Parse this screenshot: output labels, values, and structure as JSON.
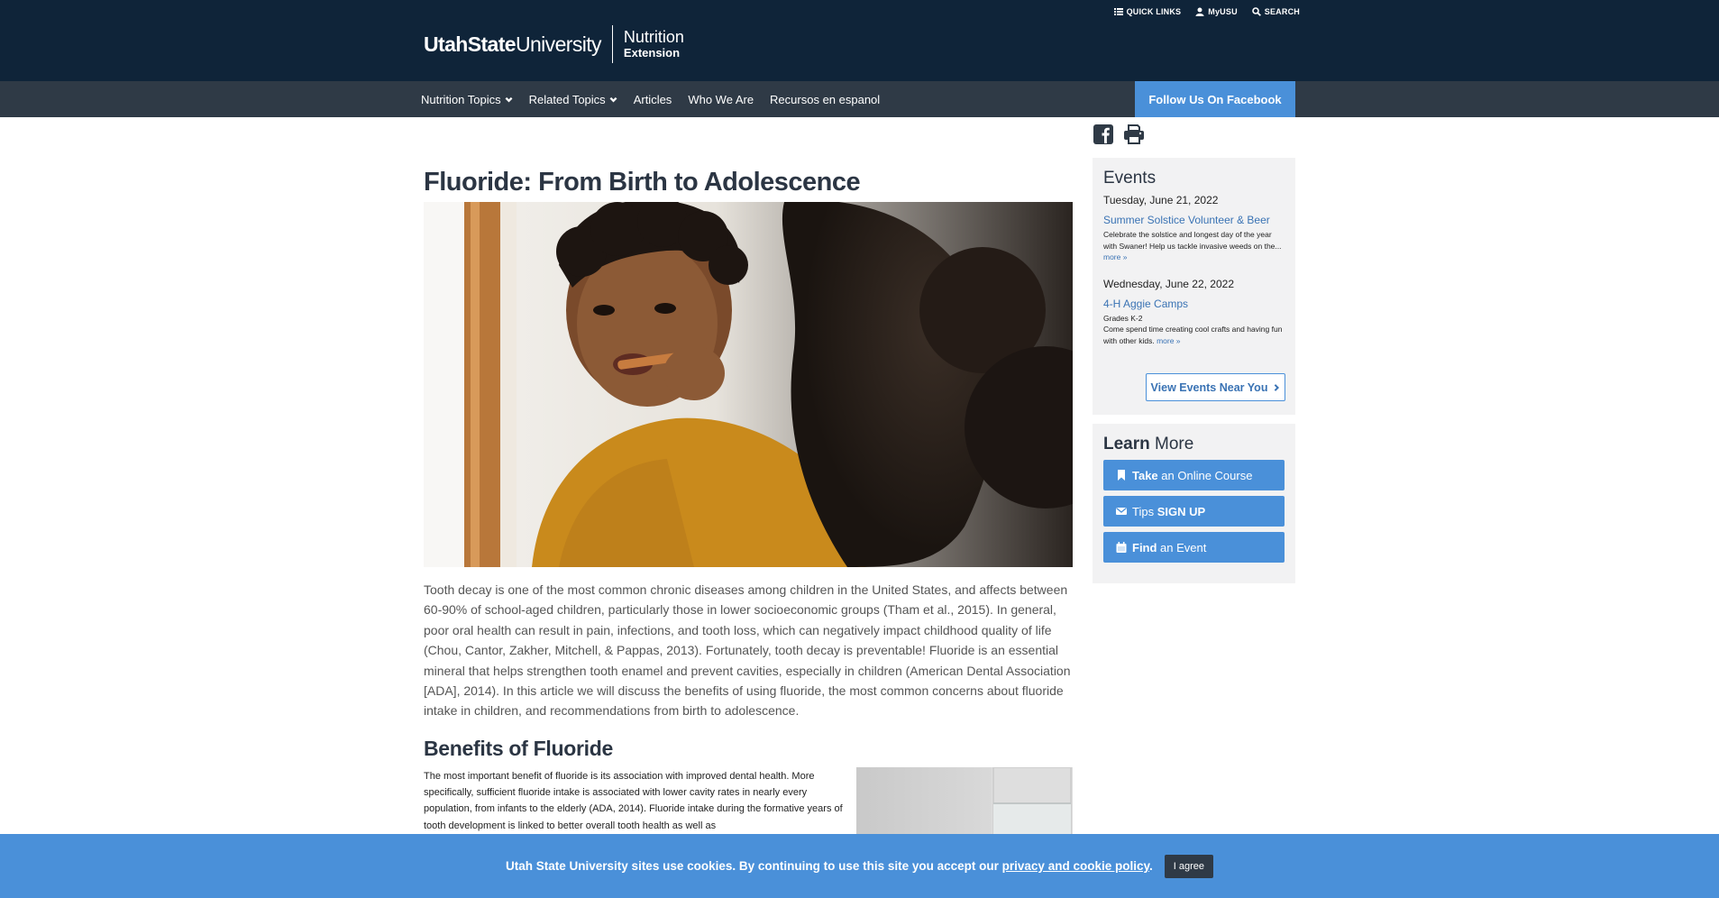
{
  "header": {
    "logo_bold": "UtahState",
    "logo_regular": "University",
    "unit_title": "Nutrition",
    "unit_subtitle": "Extension",
    "utility_links": [
      {
        "label": "QUICK LINKS",
        "icon": "list-icon"
      },
      {
        "label": "MyUSU",
        "icon": "user-icon"
      },
      {
        "label": "SEARCH",
        "icon": "search-icon"
      }
    ]
  },
  "nav": {
    "items": [
      {
        "label": "Nutrition Topics",
        "has_dropdown": true
      },
      {
        "label": "Related Topics",
        "has_dropdown": true
      },
      {
        "label": "Articles",
        "has_dropdown": false
      },
      {
        "label": "Who We Are",
        "has_dropdown": false
      },
      {
        "label": "Recursos en espanol",
        "has_dropdown": false
      }
    ],
    "facebook_button": "Follow Us On Facebook"
  },
  "article": {
    "title": "Fluoride: From Birth to Adolescence",
    "intro": "Tooth decay is one of the most common chronic diseases among children in the United States, and affects between 60-90% of school-aged children, particularly those in lower socioeconomic groups (Tham et al., 2015). In general, poor oral health can result in pain, infections, and tooth loss, which can negatively impact childhood quality of life (Chou, Cantor, Zakher, Mitchell, & Pappas, 2013). Fortunately, tooth decay is preventable! Fluoride is an essential mineral that helps strengthen tooth enamel and prevent cavities, especially in children (American Dental Association [ADA], 2014). In this article we will discuss the benefits of using fluoride, the most common concerns about fluoride intake in children, and recommendations from birth to adolescence.",
    "section_heading": "Benefits of Fluoride",
    "section_body": "The most important benefit of fluoride is its association with improved dental health. More specifically, sufficient fluoride intake is associated with lower cavity rates in nearly every population, from infants to the elderly (ADA, 2014). Fluoride intake during the formative years of tooth development is linked to better overall tooth health as well as"
  },
  "sidebar": {
    "events_title": "Events",
    "events": [
      {
        "date": "Tuesday, June 21, 2022",
        "title": "Summer Solstice Volunteer & Beer",
        "sub": "",
        "desc": "Celebrate the solstice and longest day of the year with Swaner! Help us tackle invasive weeds on the...",
        "more": "more »"
      },
      {
        "date": "Wednesday, June 22, 2022",
        "title": "4-H Aggie Camps",
        "sub": "Grades K-2",
        "desc": "Come spend time creating cool crafts and having fun with other kids.",
        "more": "more »"
      }
    ],
    "view_events": "View Events Near You",
    "learn_title_bold": "Learn",
    "learn_title_rest": " More",
    "learn_buttons": [
      {
        "bold": "Take",
        "rest": " an Online Course",
        "icon": "bookmark-icon"
      },
      {
        "bold": "SIGN UP",
        "rest": "Tips ",
        "icon": "envelope-icon"
      },
      {
        "bold": "Find",
        "rest": " an Event",
        "icon": "calendar-icon"
      }
    ]
  },
  "cookie": {
    "text": "Utah State University sites use cookies. By continuing to use this site you accept our ",
    "link": "privacy and cookie policy",
    "end": ".",
    "button": "I agree"
  }
}
